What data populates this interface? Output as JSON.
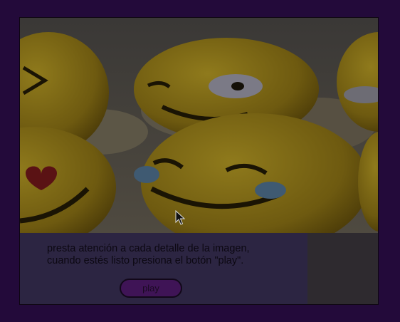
{
  "instructions": {
    "line1": "presta atención a cada detalle de la imagen,",
    "line2": "cuando estés listo presiona el botón \"play\"."
  },
  "play_button": {
    "label": "play"
  },
  "image": {
    "subject": "emoji-faces-photo"
  },
  "colors": {
    "page_background": "#230a3a",
    "panel": "#2c2542",
    "button_fill": "#3f1456",
    "emoji_yellow": "#7d6a16"
  }
}
